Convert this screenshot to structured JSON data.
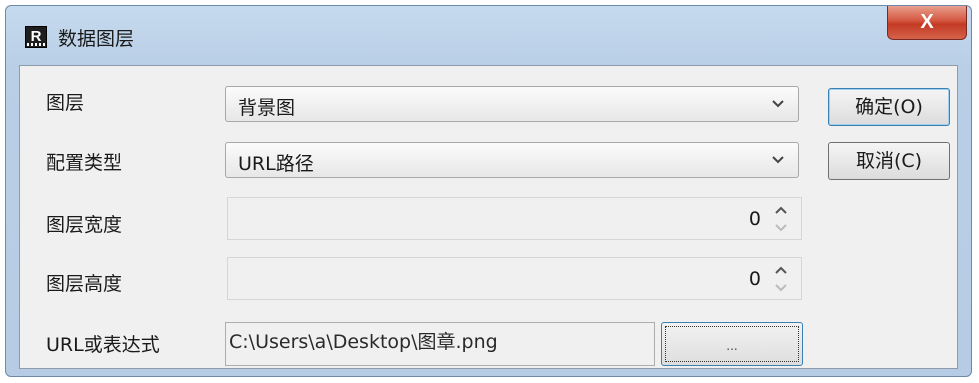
{
  "window": {
    "title": "数据图层",
    "app_icon_letter": "R",
    "close_label": "X",
    "icons": {
      "app": "report-designer-icon",
      "close": "close-icon",
      "dropdown": "chevron-down-icon",
      "spinner": "spinner-arrows-icon"
    }
  },
  "form": {
    "layer": {
      "label": "图层",
      "value": "背景图"
    },
    "config_type": {
      "label": "配置类型",
      "value": "URL路径"
    },
    "layer_width": {
      "label": "图层宽度",
      "value": "0"
    },
    "layer_height": {
      "label": "图层高度",
      "value": "0"
    },
    "url": {
      "label": "URL或表达式",
      "value": "C:\\Users\\a\\Desktop\\图章.png",
      "browse_label": "..."
    }
  },
  "buttons": {
    "ok": "确定(O)",
    "cancel": "取消(C)"
  }
}
